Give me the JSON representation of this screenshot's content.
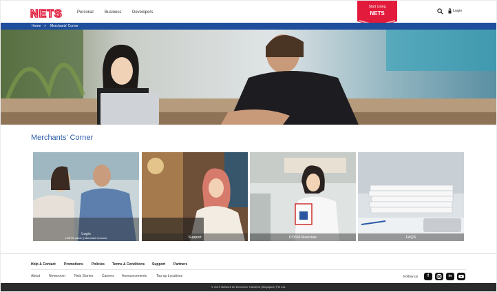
{
  "header": {
    "logo_text": "NETS",
    "nav": [
      "Personal",
      "Business",
      "Developers"
    ],
    "cta_top": "Start Using",
    "cta_main": "NETS",
    "login": "Login"
  },
  "breadcrumb": {
    "home": "Home",
    "sep": ">",
    "current": "Merchants' Corner"
  },
  "section_title": "Merchants' Corner",
  "tiles": [
    {
      "label": "Login",
      "sub": "eNETS admin | Merchant Connect"
    },
    {
      "label": "Support"
    },
    {
      "label": "POSM Materials"
    },
    {
      "label": "FAQS"
    }
  ],
  "footer": {
    "primary_links": [
      "Help & Contact",
      "Promotions",
      "Policies",
      "Terms & Conditions",
      "Support",
      "Partners"
    ],
    "secondary_links": [
      "About",
      "Newsroom",
      "Nets Stories",
      "Careers",
      "Announcements",
      "Top-up Locations"
    ],
    "follow_label": "Follow us",
    "social_icons": [
      "facebook-icon",
      "instagram-icon",
      "linkedin-icon",
      "youtube-icon"
    ],
    "copyright": "© 2019 Network for Electronic Transfers (Singapore) Pte Ltd."
  },
  "colors": {
    "brand_red": "#e21b3c",
    "brand_blue": "#1f4e9c",
    "title_blue": "#2a5aa8"
  }
}
